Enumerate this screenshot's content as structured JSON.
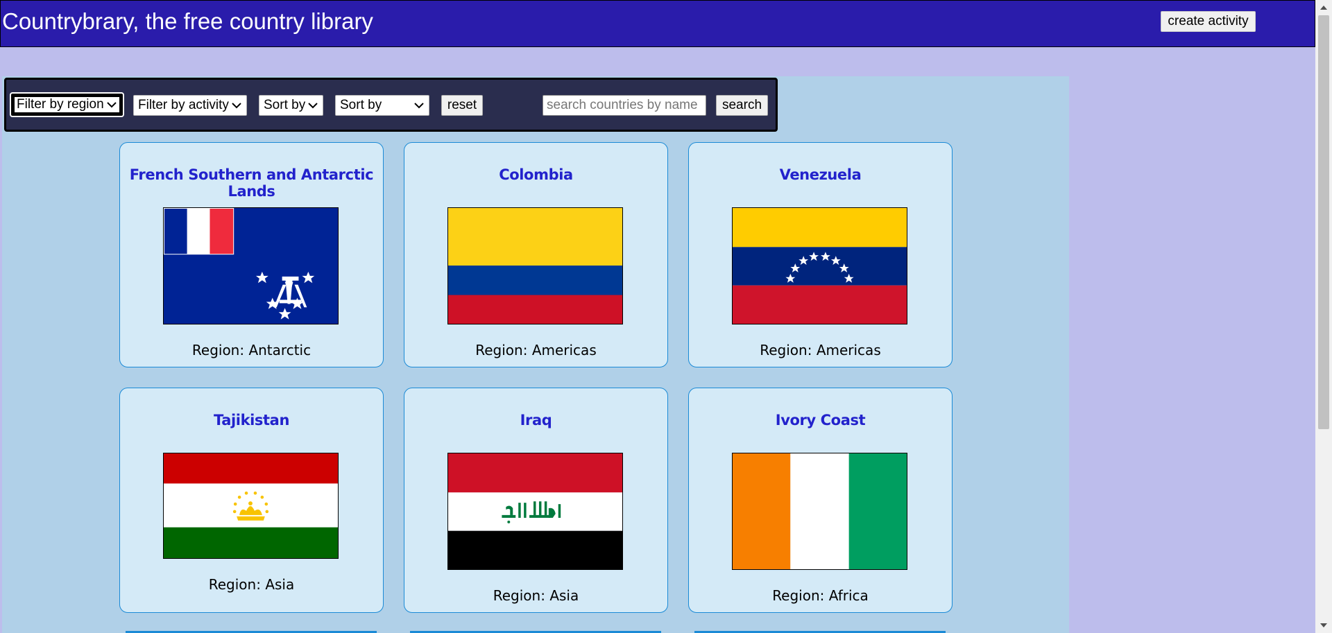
{
  "header": {
    "title": "Countrybrary, the free country library",
    "create_label": "create activity"
  },
  "filters": {
    "region_label": "Filter by region",
    "activity_label": "Filter by activity",
    "sort1_label": "Sort by",
    "sort2_label": "Sort by",
    "reset_label": "reset",
    "search_placeholder": "search countries by name",
    "search_label": "search"
  },
  "cards": [
    {
      "name": "French Southern and Antarctic Lands",
      "region": "Region: Antarctic"
    },
    {
      "name": "Colombia",
      "region": "Region: Americas"
    },
    {
      "name": "Venezuela",
      "region": "Region: Americas"
    },
    {
      "name": "Tajikistan",
      "region": "Region: Asia"
    },
    {
      "name": "Iraq",
      "region": "Region: Asia"
    },
    {
      "name": "Ivory Coast",
      "region": "Region: Africa"
    }
  ],
  "colors": {
    "header_bg": "#2a1cab",
    "page_bg": "#bdbdec",
    "content_bg": "#b0d0e8",
    "card_bg": "#d4eaf7",
    "card_border": "#1a8ad6",
    "card_title": "#2222cc",
    "filterbar_bg": "#2a2d4e"
  }
}
